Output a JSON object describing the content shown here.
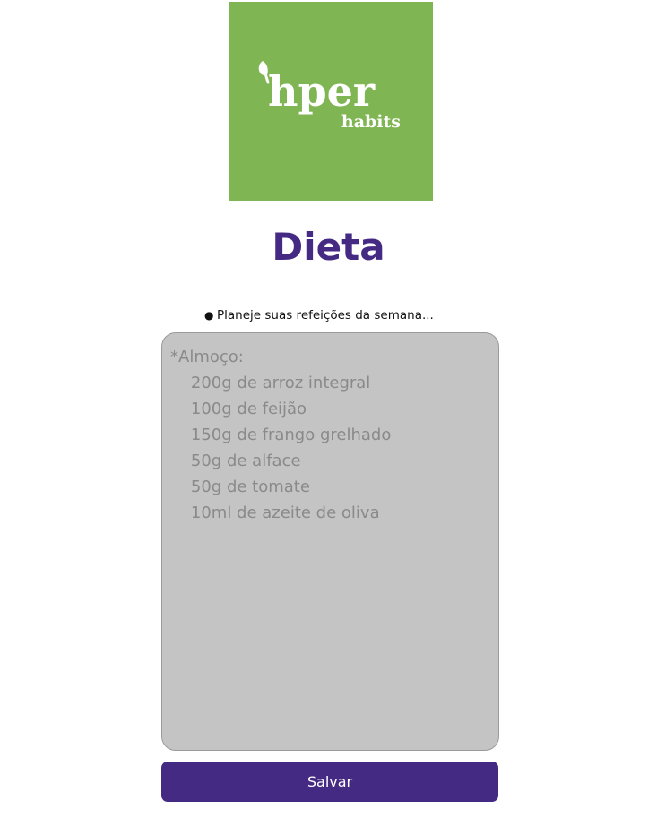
{
  "logo": {
    "brand_main": "hper",
    "brand_sub": "habits",
    "background_color": "#80b553",
    "icon": "leaf-icon"
  },
  "page": {
    "title": "Dieta",
    "title_color": "#452a84"
  },
  "tips": [
    {
      "text": "Planeje suas refeições da semana..."
    }
  ],
  "diet_form": {
    "textarea_value": "",
    "textarea_placeholder": "*Almoço:\n    200g de arroz integral\n    100g de feijão\n    150g de frango grelhado\n    50g de alface\n    50g de tomate\n    10ml de azeite de oliva",
    "textarea_background": "#c4c4c4",
    "save_label": "Salvar",
    "save_color": "#452a84"
  }
}
